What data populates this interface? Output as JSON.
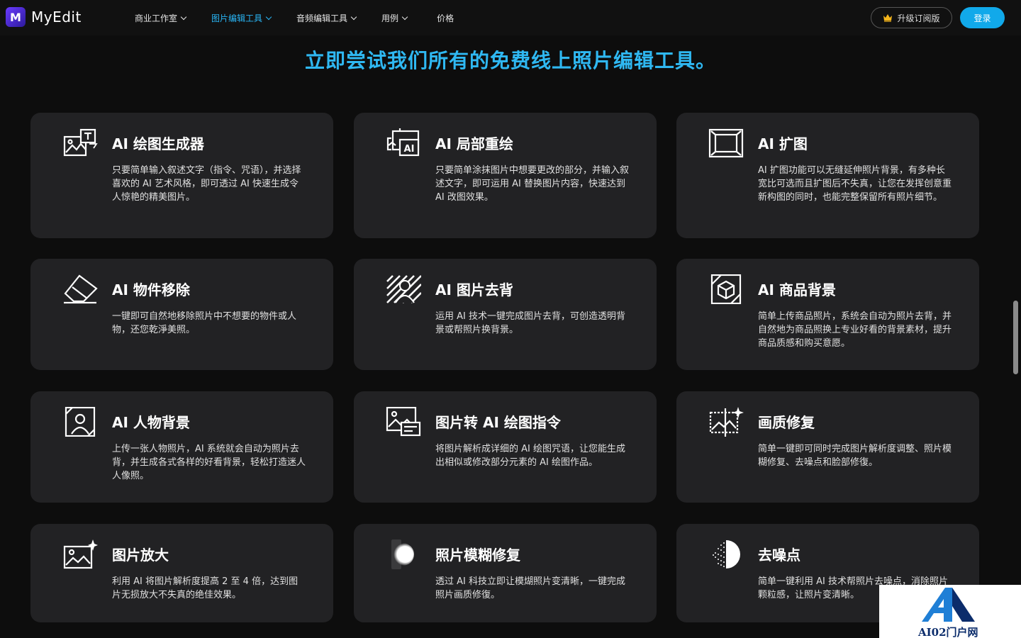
{
  "brand": {
    "name": "MyEdit",
    "logo_letter": "M"
  },
  "nav": {
    "items": [
      {
        "label": "商业工作室",
        "has_dropdown": true,
        "active": false
      },
      {
        "label": "图片编辑工具",
        "has_dropdown": true,
        "active": true
      },
      {
        "label": "音频编辑工具",
        "has_dropdown": true,
        "active": false
      },
      {
        "label": "用例",
        "has_dropdown": true,
        "active": false
      },
      {
        "label": "价格",
        "has_dropdown": false,
        "active": false
      }
    ],
    "upgrade_label": "升级订阅版",
    "login_label": "登录"
  },
  "section_title": "立即尝试我们所有的免费线上照片编辑工具。",
  "tools": [
    {
      "title": "AI 绘图生成器",
      "desc": "只要简单输入叙述文字（指令、咒语），并选择喜欢的 AI 艺术风格，即可透过 AI 快速生成令人惊艳的精美图片。",
      "icon": "text-to-image-icon"
    },
    {
      "title": "AI 局部重绘",
      "desc": "只要简单涂抹图片中想要更改的部分，并输入叙述文字，即可运用 AI 替换图片内容，快速达到 AI 改图效果。",
      "icon": "ai-replace-icon"
    },
    {
      "title": "AI 扩图",
      "desc": "AI 扩图功能可以无缝延伸照片背景，有多种长宽比可选而且扩图后不失真，让您在发挥创意重新构图的同时，也能完整保留所有照片细节。",
      "icon": "expand-icon"
    },
    {
      "title": "AI 物件移除",
      "desc": "一键即可自然地移除照片中不想要的物件或人物，还您乾淨美照。",
      "icon": "eraser-icon"
    },
    {
      "title": "AI 图片去背",
      "desc": "运用 AI 技术一键完成图片去背，可创造透明背景或帮照片换背景。",
      "icon": "background-remove-icon"
    },
    {
      "title": "AI 商品背景",
      "desc": "简单上传商品照片，系统会自动为照片去背，并自然地为商品照换上专业好看的背景素材，提升商品质感和购买意愿。",
      "icon": "product-background-icon"
    },
    {
      "title": "AI 人物背景",
      "desc": "上传一张人物照片，AI 系统就会自动为照片去背，并生成各式各样的好看背景，轻松打造迷人人像照。",
      "icon": "portrait-background-icon"
    },
    {
      "title": "图片转 AI 绘图指令",
      "desc": "将图片解析成详细的 AI 绘图咒语，让您能生成出相似或修改部分元素的 AI 绘图作品。",
      "icon": "image-to-prompt-icon"
    },
    {
      "title": "画质修复",
      "desc": "简单一键即可同时完成图片解析度调整、照片模糊修复、去噪点和脸部修復。",
      "icon": "enhance-icon"
    },
    {
      "title": "图片放大",
      "desc": "利用 AI 将图片解析度提高 2 至 4 倍，达到图片无损放大不失真的绝佳效果。",
      "icon": "upscale-icon"
    },
    {
      "title": "照片模糊修复",
      "desc": "透过 AI 科技立即让模煳照片变清晰，一键完成照片画质修復。",
      "icon": "unblur-icon"
    },
    {
      "title": "去噪点",
      "desc": "简单一键利用 AI 技术帮照片去噪点，消除照片颗粒感，让照片变清晰。",
      "icon": "denoise-icon"
    }
  ],
  "watermark": {
    "text": "AI02门户网"
  }
}
